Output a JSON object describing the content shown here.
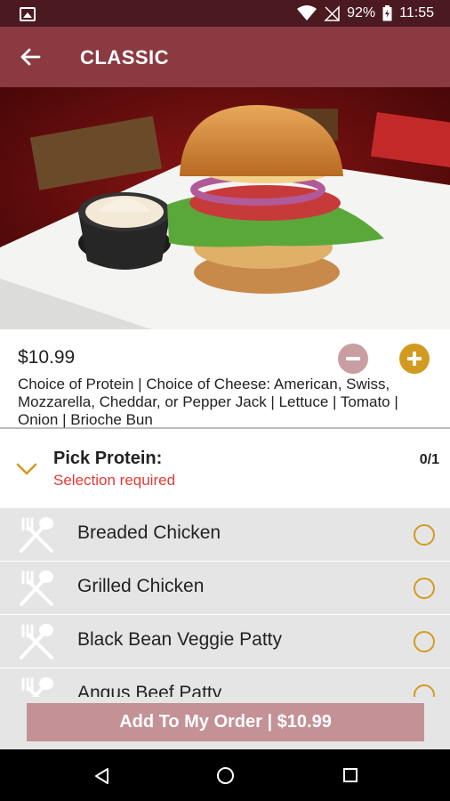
{
  "status_bar": {
    "battery": "92%",
    "time": "11:55"
  },
  "app_bar": {
    "title": "CLASSIC"
  },
  "item": {
    "price": "$10.99",
    "description": "Choice of Protein | Choice of Cheese: American, Swiss, Mozzarella, Cheddar,  or Pepper Jack | Lettuce | Tomato | Onion | Brioche Bun"
  },
  "section": {
    "title": "Pick Protein:",
    "requirement": "Selection required",
    "count": "0/1"
  },
  "options": [
    {
      "label": "Breaded Chicken"
    },
    {
      "label": "Grilled Chicken"
    },
    {
      "label": "Black Bean Veggie Patty"
    },
    {
      "label": "Angus Beef Patty"
    }
  ],
  "add_button": {
    "label": "Add To My Order | $10.99"
  },
  "colors": {
    "status_bar": "#4a1a20",
    "app_bar": "#8b3a42",
    "accent_gold": "#d39a22",
    "required_red": "#e53935",
    "add_button": "#c39196"
  }
}
